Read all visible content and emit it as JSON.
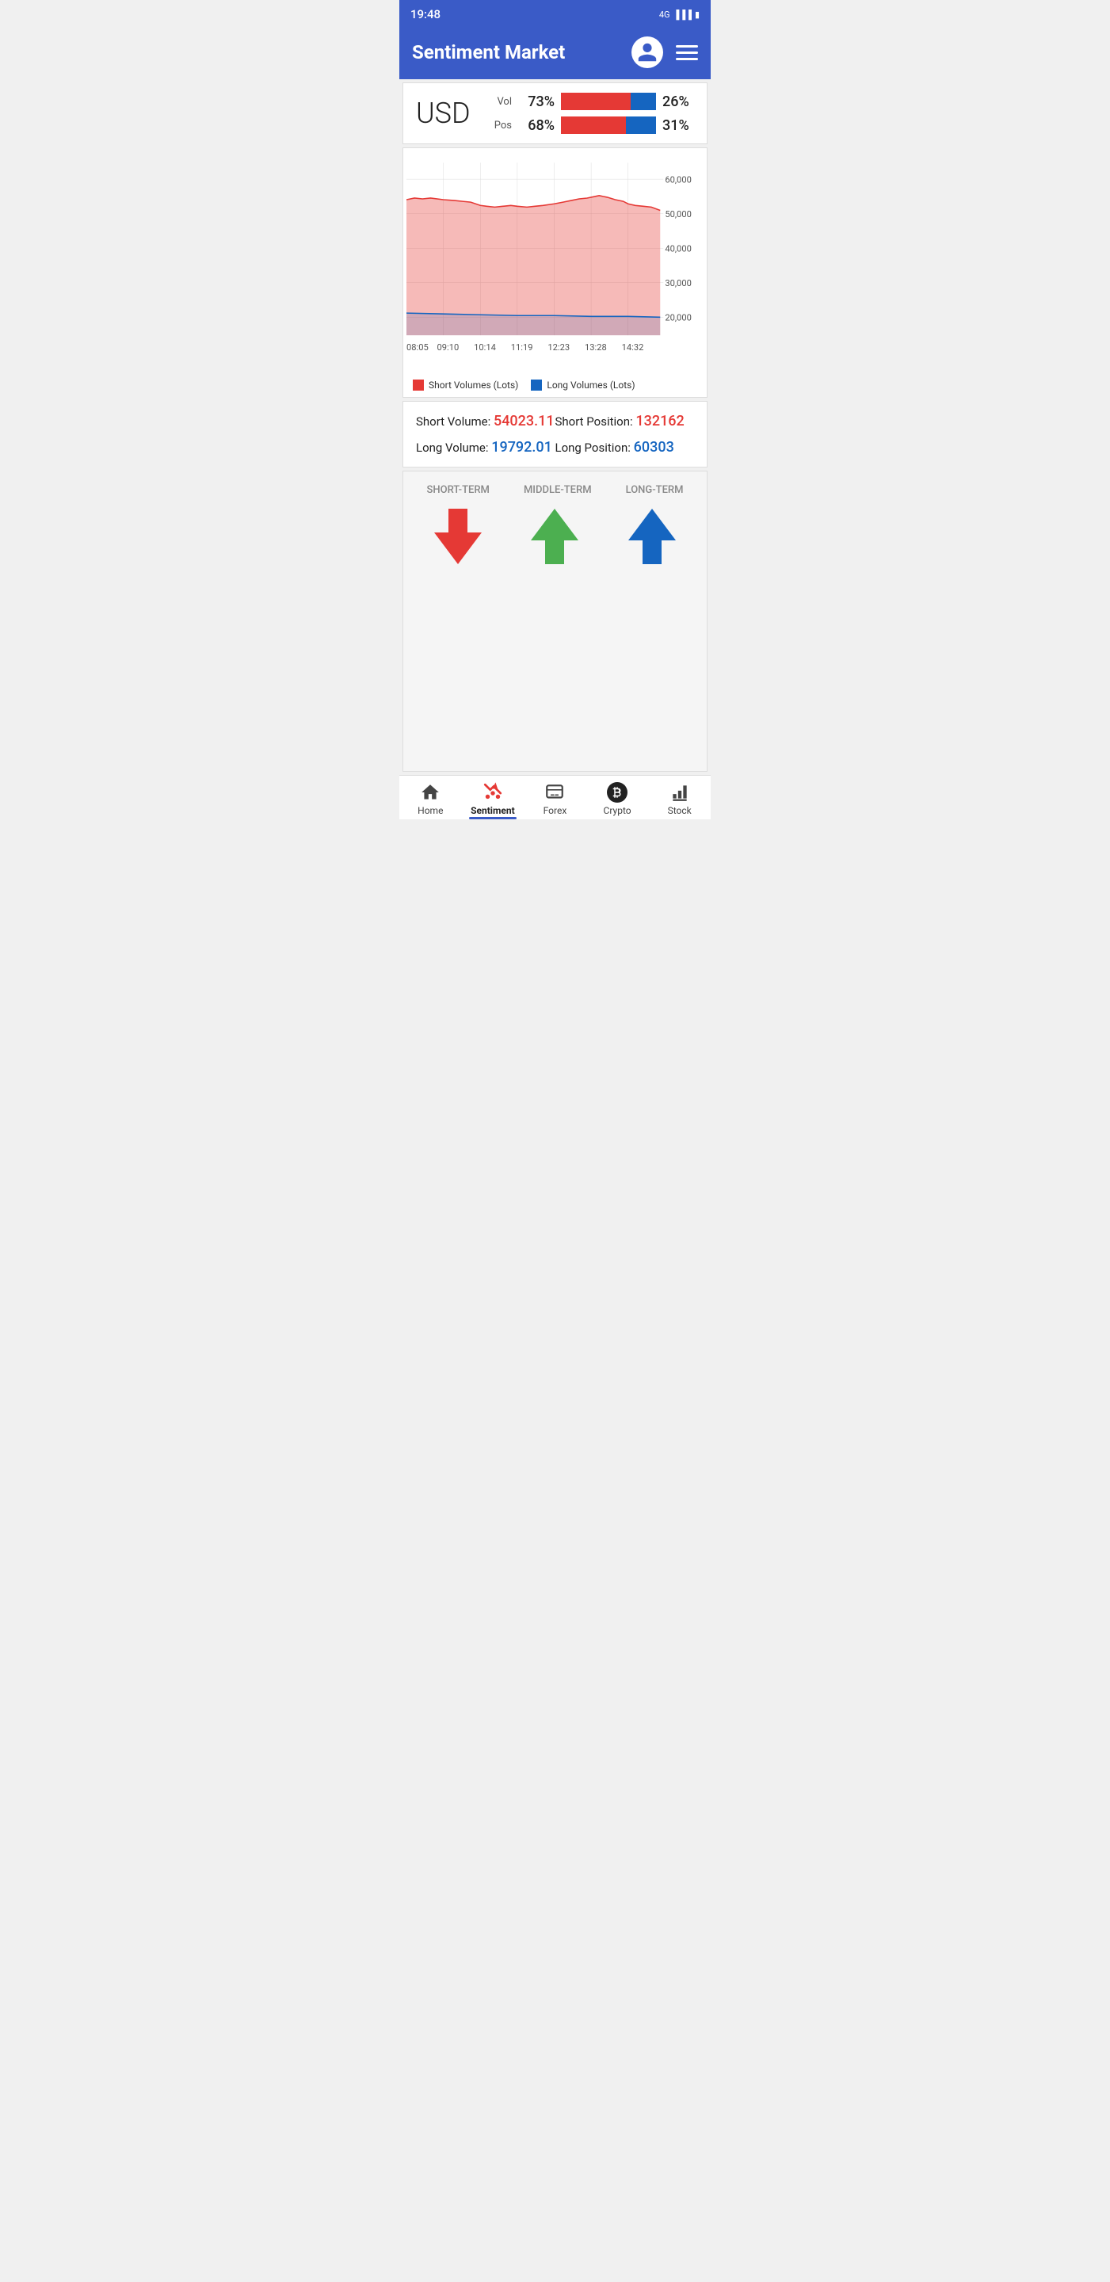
{
  "status_bar": {
    "time": "19:48",
    "signal": "4G"
  },
  "header": {
    "title": "Sentiment Market"
  },
  "currency": {
    "name": "USD",
    "vol_label": "Vol",
    "vol_left_pct": "73%",
    "vol_right_pct": "26%",
    "vol_red_width": 73,
    "vol_blue_width": 27,
    "pos_label": "Pos",
    "pos_left_pct": "68%",
    "pos_right_pct": "31%",
    "pos_red_width": 68,
    "pos_blue_width": 32
  },
  "chart": {
    "x_labels": [
      "08:05",
      "09:10",
      "10:14",
      "11:19",
      "12:23",
      "13:28",
      "14:32"
    ],
    "y_labels": [
      "60,000",
      "50,000",
      "40,000",
      "30,000",
      "20,000"
    ],
    "legend_short": "Short Volumes (Lots)",
    "legend_long": "Long Volumes (Lots)"
  },
  "stats": {
    "short_volume_label": "Short Volume:",
    "short_volume_value": "54023.11",
    "short_position_label": "Short Position:",
    "short_position_value": "132162",
    "long_volume_label": "Long Volume:",
    "long_volume_value": "19792.01",
    "long_position_label": "Long Position:",
    "long_position_value": "60303"
  },
  "terms": {
    "short_label": "SHORT-TERM",
    "middle_label": "MIDDLE-TERM",
    "long_label": "LONG-TERM",
    "short_direction": "down",
    "middle_direction": "up_green",
    "long_direction": "up_blue"
  },
  "bottom_nav": {
    "items": [
      {
        "id": "home",
        "label": "Home",
        "active": false
      },
      {
        "id": "sentiment",
        "label": "Sentiment",
        "active": true
      },
      {
        "id": "forex",
        "label": "Forex",
        "active": false
      },
      {
        "id": "crypto",
        "label": "Crypto",
        "active": false
      },
      {
        "id": "stock",
        "label": "Stock",
        "active": false
      }
    ]
  }
}
